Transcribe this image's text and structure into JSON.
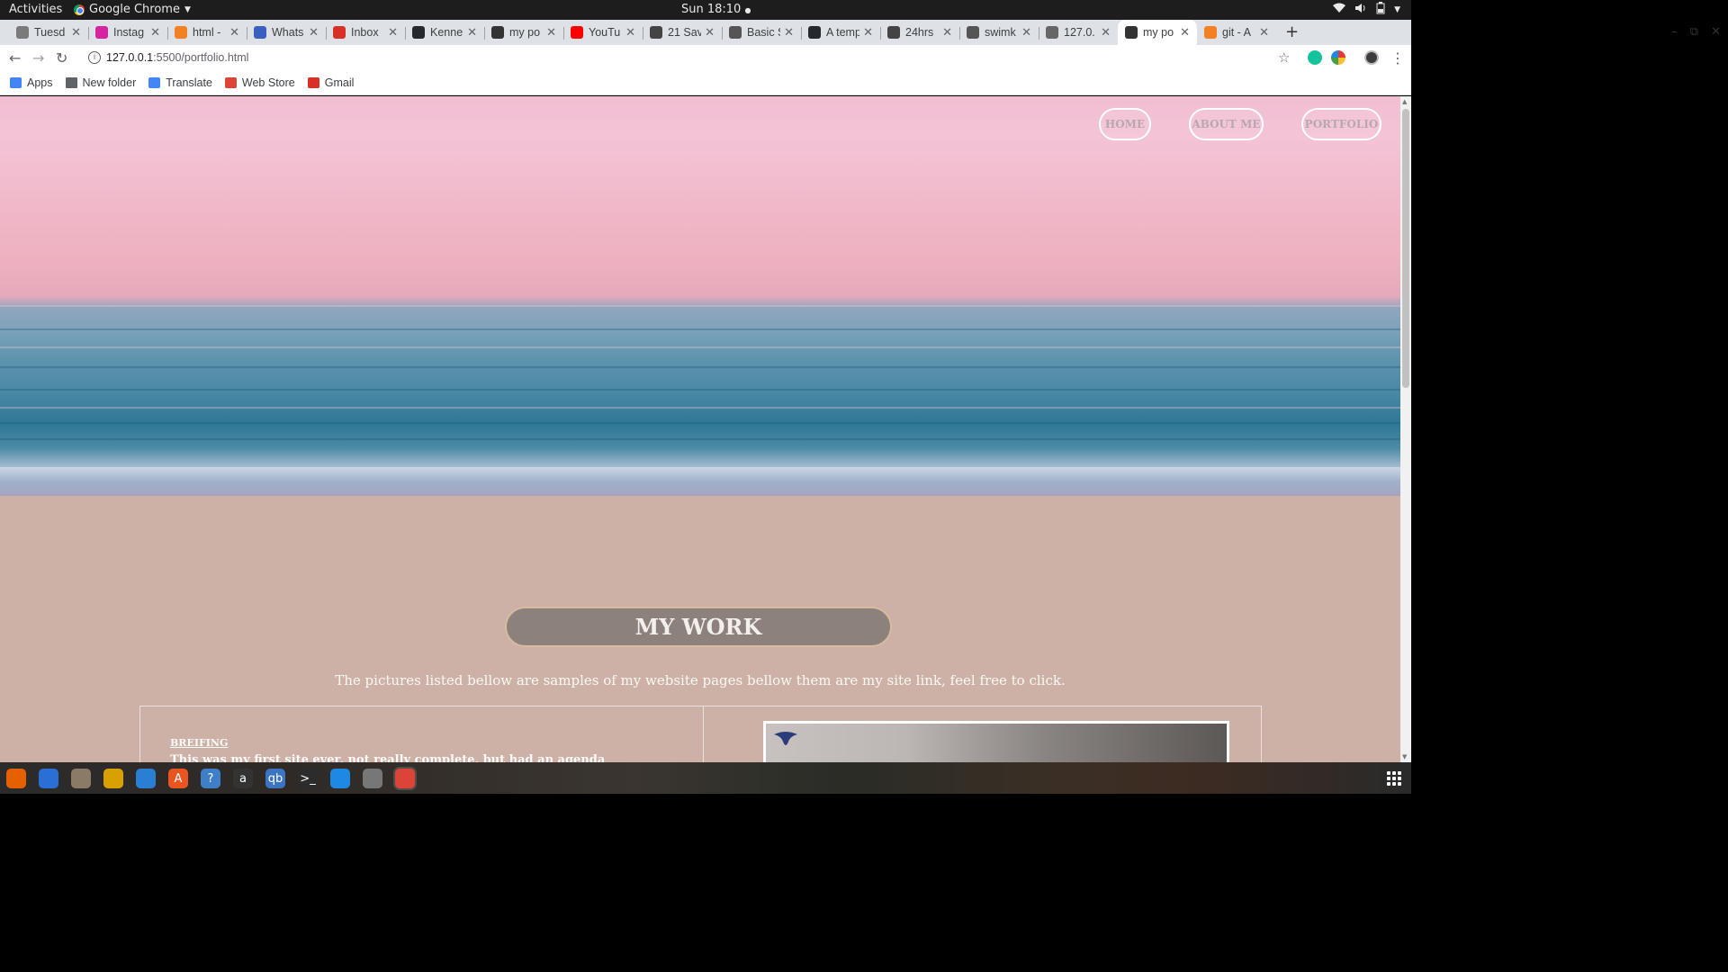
{
  "system": {
    "activities": "Activities",
    "app_name": "Google Chrome",
    "clock": "Sun 18:10"
  },
  "tabs": [
    {
      "title": "Tuesd",
      "color": "#7a7a7a"
    },
    {
      "title": "Instag",
      "color": "#d6249f"
    },
    {
      "title": "html -",
      "color": "#f48024"
    },
    {
      "title": "Whats",
      "color": "#3b5fc0"
    },
    {
      "title": "Inbox",
      "color": "#d93025"
    },
    {
      "title": "Kenne",
      "color": "#24292e"
    },
    {
      "title": "my po",
      "color": "#333333"
    },
    {
      "title": "YouTu",
      "color": "#ff0000"
    },
    {
      "title": "21 Sav",
      "color": "#444444"
    },
    {
      "title": "Basic S",
      "color": "#555555"
    },
    {
      "title": "A temp",
      "color": "#24292e"
    },
    {
      "title": "24hrs",
      "color": "#444444"
    },
    {
      "title": "swimk",
      "color": "#555555"
    },
    {
      "title": "127.0.",
      "color": "#666666"
    },
    {
      "title": "my po",
      "color": "#333333",
      "active": true
    },
    {
      "title": "git - A",
      "color": "#f48024"
    }
  ],
  "toolbar": {
    "url_host": "127.0.0.1",
    "url_path": ":5500/portfolio.html"
  },
  "bookmarks": [
    {
      "label": "Apps",
      "icon": "apps-grid-icon"
    },
    {
      "label": "New folder",
      "icon": "folder-icon"
    },
    {
      "label": "Translate",
      "icon": "translate-icon"
    },
    {
      "label": "Web Store",
      "icon": "webstore-icon"
    },
    {
      "label": "Gmail",
      "icon": "gmail-icon"
    }
  ],
  "page": {
    "nav": {
      "home": "HOME",
      "about": "ABOUT ME",
      "portfolio": "PORTFOLIO"
    },
    "section_title": "MY WORK",
    "intro": "The pictures listed bellow are samples of my website pages bellow them are my site link, feel free to click.",
    "work_item": {
      "heading": "BREIFING",
      "text": "This was my first site ever, not really complete, but had an agenda"
    },
    "colors": {
      "background": "#cdb1a6",
      "pill_bg": "#8d817c",
      "pill_border": "#d6bb9f"
    }
  },
  "dock": [
    {
      "name": "firefox",
      "glyph": "",
      "color": "#e66000"
    },
    {
      "name": "thunderbird",
      "glyph": "",
      "color": "#2a6fd6"
    },
    {
      "name": "files",
      "glyph": "",
      "color": "#8b7a66"
    },
    {
      "name": "rhythmbox",
      "glyph": "",
      "color": "#d8a000"
    },
    {
      "name": "writer",
      "glyph": "",
      "color": "#2a7fd4"
    },
    {
      "name": "software",
      "glyph": "A",
      "color": "#e95420"
    },
    {
      "name": "help",
      "glyph": "?",
      "color": "#3f7fc7"
    },
    {
      "name": "amazon",
      "glyph": "a",
      "color": "#333333"
    },
    {
      "name": "qbittorrent",
      "glyph": "qb",
      "color": "#3c74c4"
    },
    {
      "name": "terminal",
      "glyph": ">_",
      "color": "#2c2c2c"
    },
    {
      "name": "vscode",
      "glyph": "",
      "color": "#1e88e5"
    },
    {
      "name": "inkscape",
      "glyph": "",
      "color": "#777777"
    },
    {
      "name": "chrome",
      "glyph": "",
      "color": "#db4437",
      "active": true
    }
  ]
}
